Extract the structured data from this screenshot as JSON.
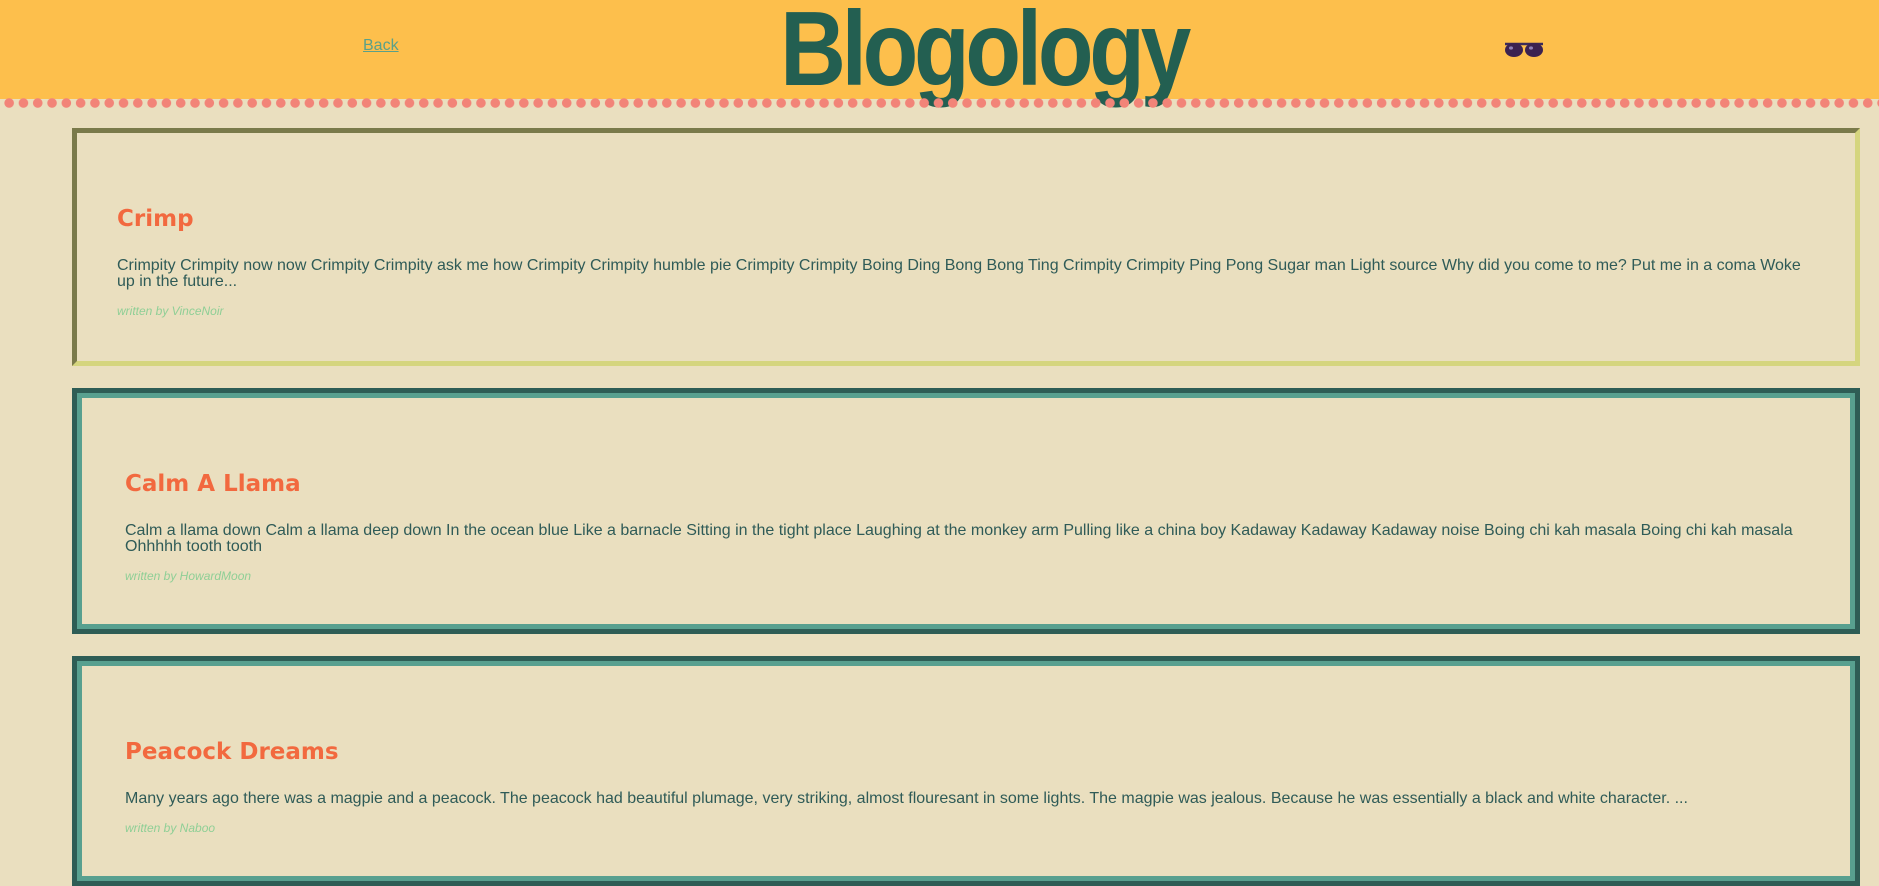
{
  "header": {
    "back_label": "Back",
    "site_title": "Blogology",
    "accent_color": "#fdbf4c",
    "icon": "sunglasses-icon"
  },
  "posts": [
    {
      "title": "Crimp",
      "excerpt": "Crimpity Crimpity now now Crimpity Crimpity ask me how Crimpity Crimpity humble pie Crimpity Crimpity Boing Ding Bong Bong Ting Crimpity Crimpity Ping Pong Sugar man Light source Why did you come to me? Put me in a coma Woke up in the future...",
      "author": "written by VinceNoir"
    },
    {
      "title": "Calm A Llama",
      "excerpt": "Calm a llama down Calm a llama deep down In the ocean blue Like a barnacle Sitting in the tight place Laughing at the monkey arm Pulling like a china boy Kadaway Kadaway Kadaway noise Boing chi kah masala Boing chi kah masala Ohhhhh tooth tooth",
      "author": "written by HowardMoon"
    },
    {
      "title": "Peacock Dreams",
      "excerpt": "Many years ago there was a magpie and a peacock. The peacock had beautiful plumage, very striking, almost flouresant in some lights. The magpie was jealous. Because he was essentially a black and white character. ...",
      "author": "written by Naboo"
    }
  ]
}
